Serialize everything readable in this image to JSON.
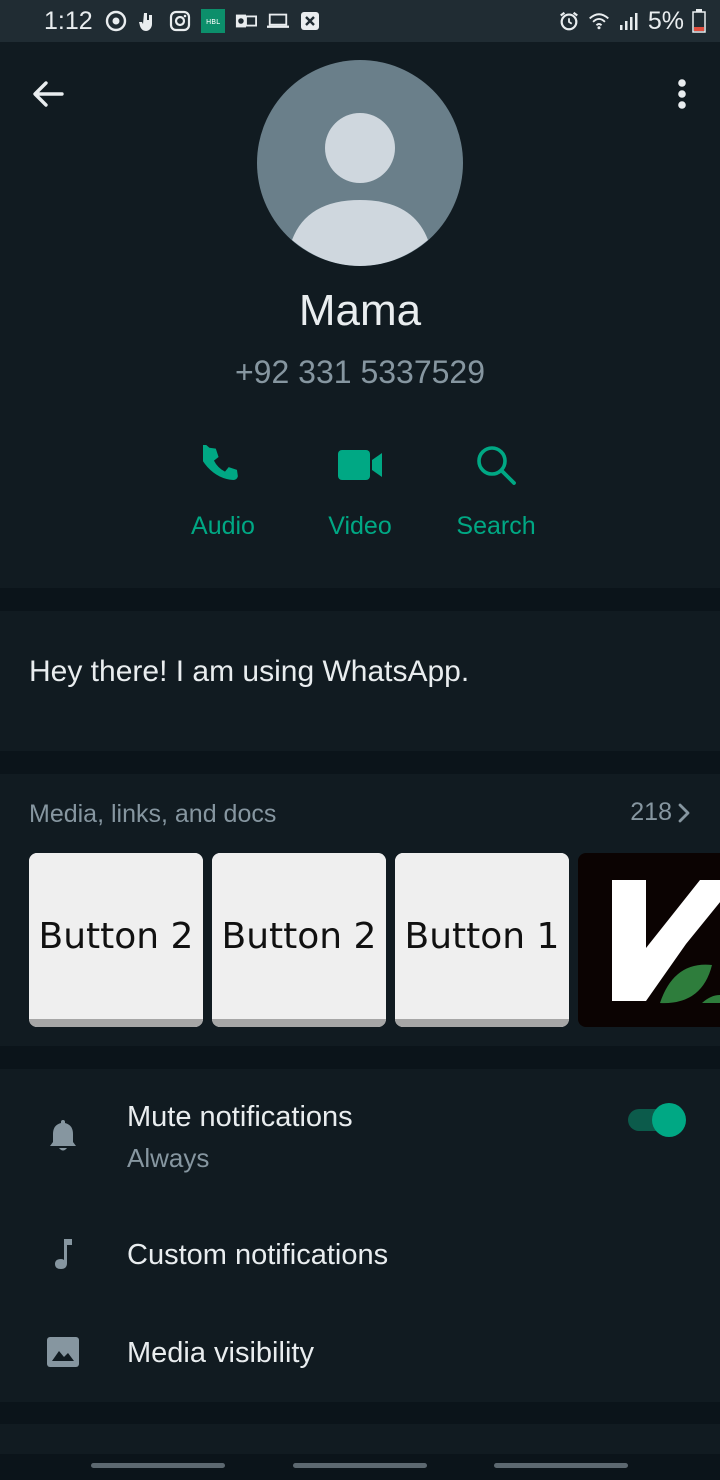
{
  "status_bar": {
    "time": "1:12",
    "battery": "5%",
    "left_icons": [
      "sync-icon",
      "hand-icon",
      "instagram-icon",
      "hbl-icon",
      "outlook-icon",
      "laptop-icon",
      "x-icon"
    ],
    "right_icons": [
      "alarm-icon",
      "wifi-icon",
      "signal-icon",
      "battery-icon"
    ],
    "hbl_label": "HBL"
  },
  "header": {
    "name": "Mama",
    "phone": "+92 331 5337529",
    "actions": [
      {
        "label": "Audio",
        "icon": "phone-icon"
      },
      {
        "label": "Video",
        "icon": "video-camera-icon"
      },
      {
        "label": "Search",
        "icon": "search-icon"
      }
    ]
  },
  "about": {
    "text": "Hey there! I am using WhatsApp."
  },
  "media": {
    "title": "Media, links, and docs",
    "count": "218",
    "thumbnails": [
      {
        "label": "Button 2"
      },
      {
        "label": "Button 2"
      },
      {
        "label": "Button 1"
      },
      {
        "label": "K"
      }
    ]
  },
  "settings": {
    "mute": {
      "title": "Mute notifications",
      "subtitle": "Always",
      "enabled": true
    },
    "custom": {
      "title": "Custom notifications"
    },
    "visibility": {
      "title": "Media visibility"
    }
  },
  "colors": {
    "accent": "#00a884",
    "background": "#111b21",
    "divider": "#0b141a",
    "primary_text": "#e9edef",
    "secondary_text": "#8696a0"
  }
}
